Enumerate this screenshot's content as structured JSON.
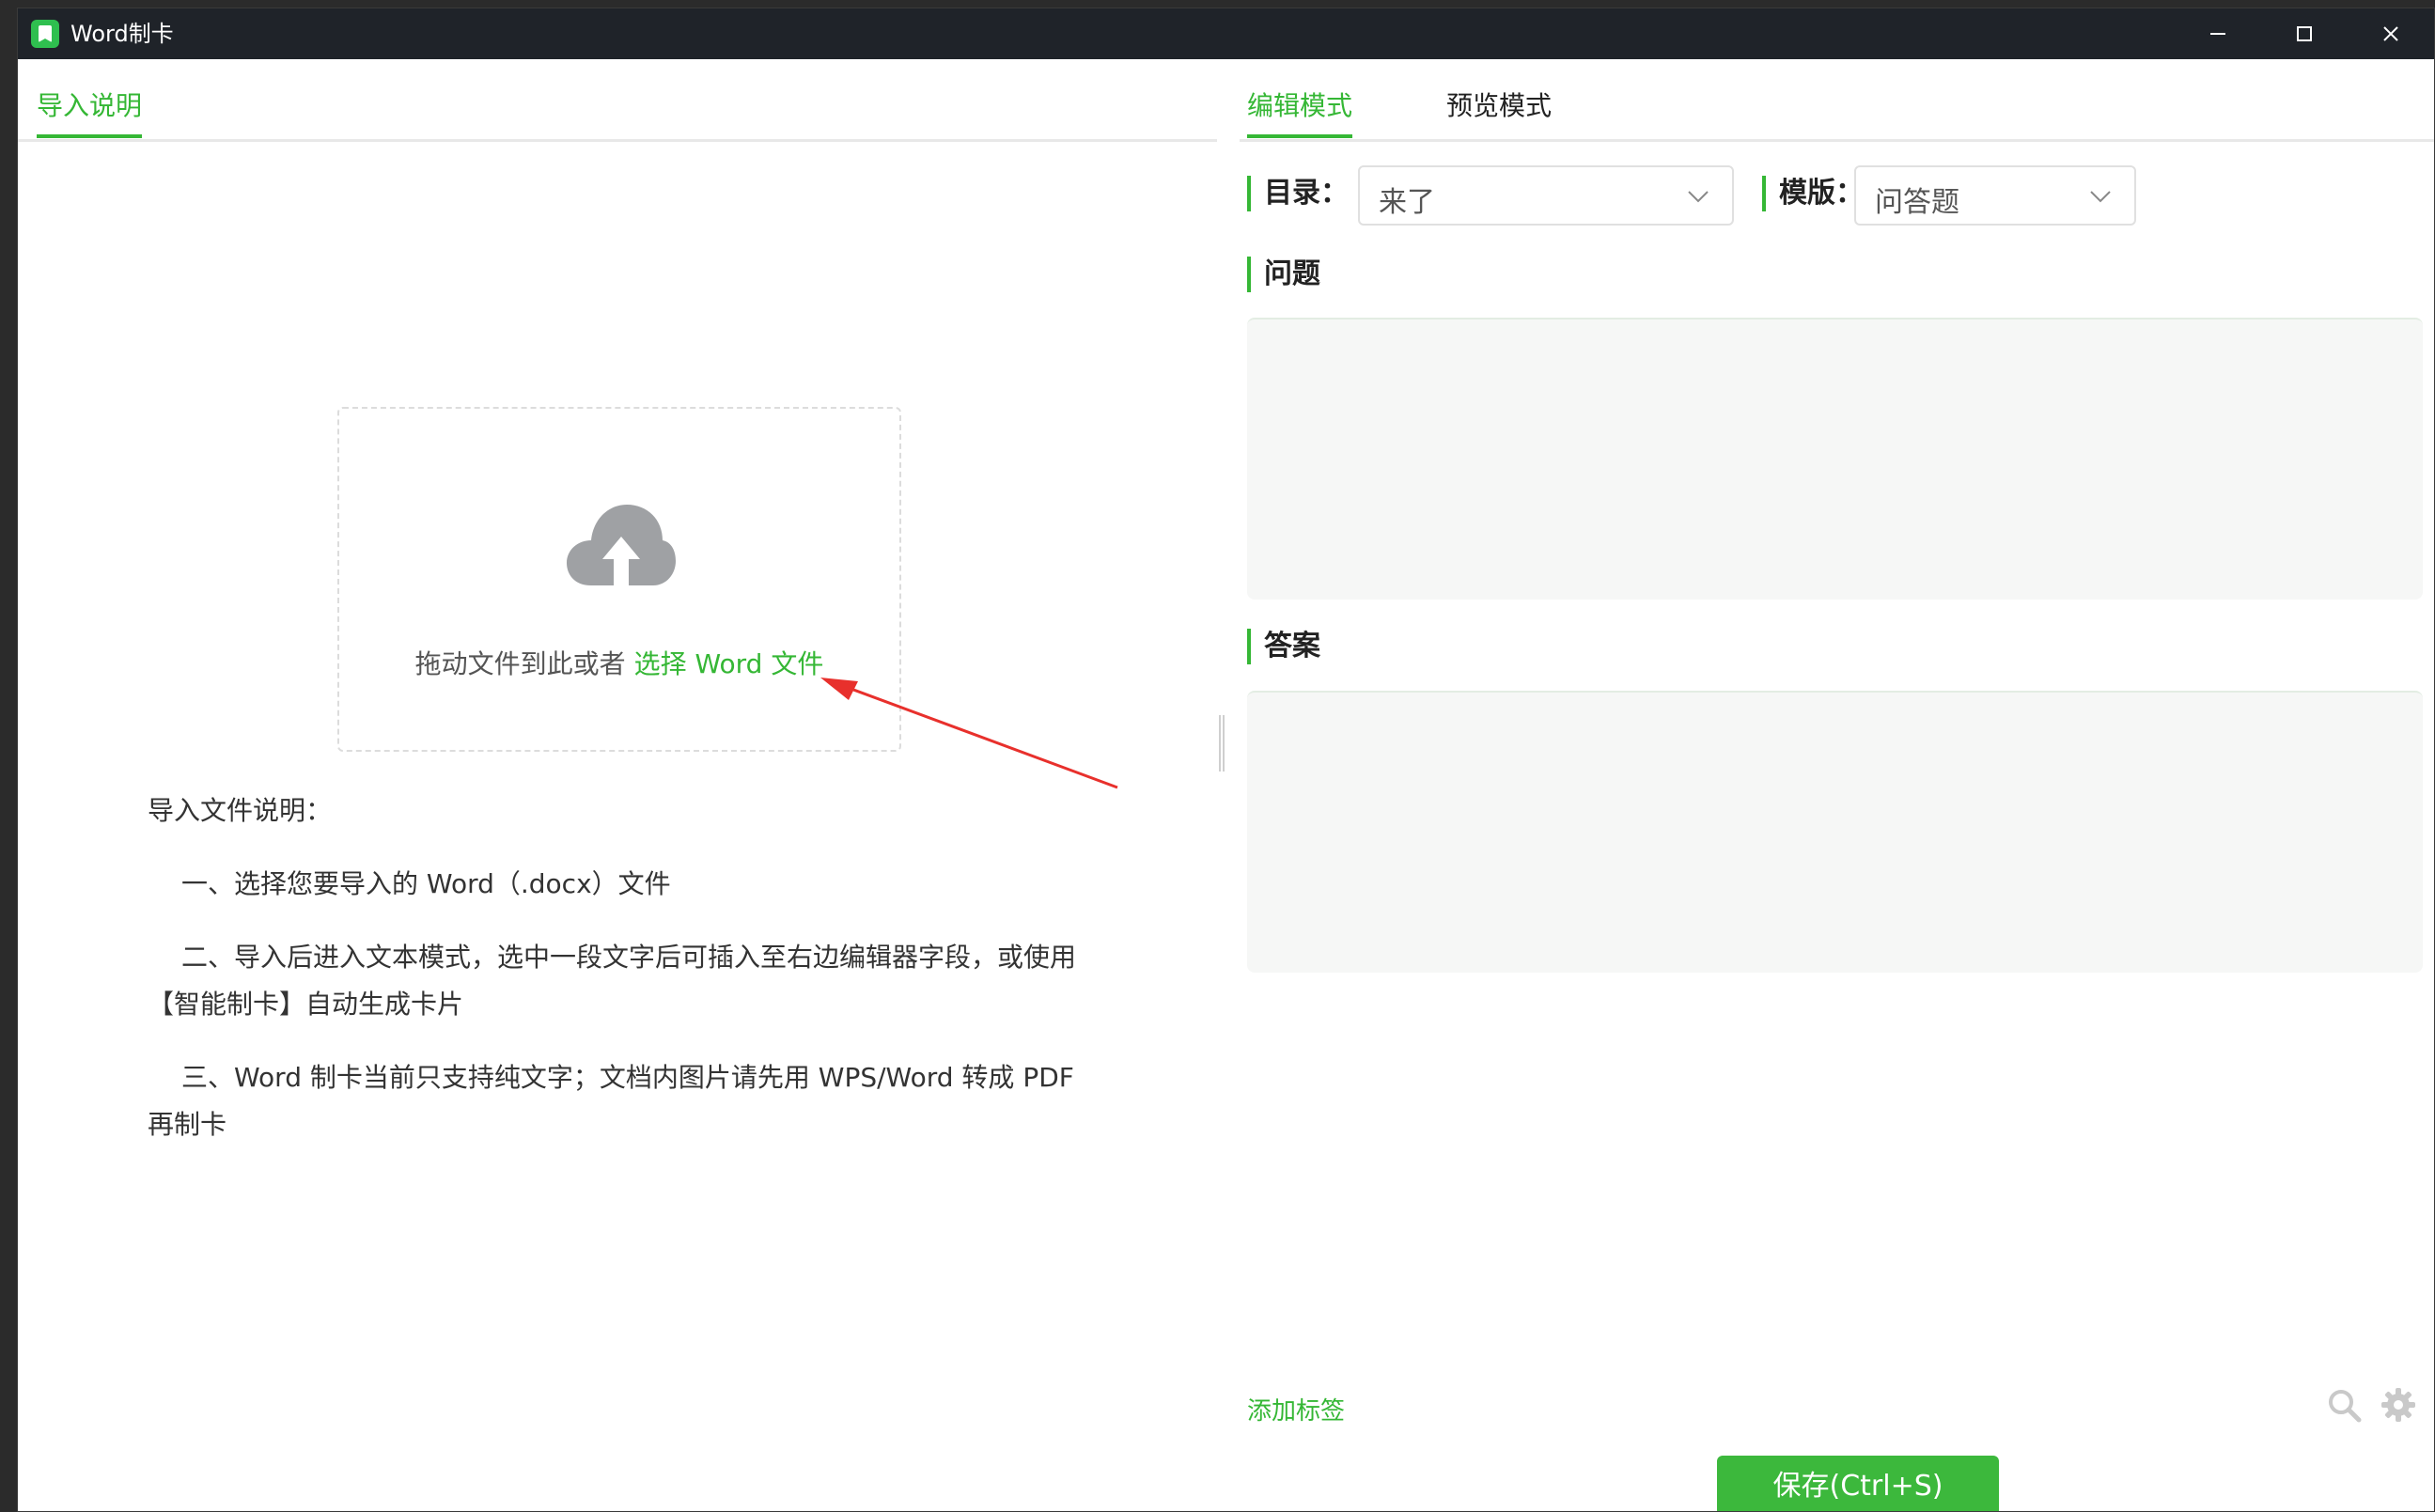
{
  "window": {
    "title": "Word制卡"
  },
  "left_panel": {
    "tab_label": "导入说明",
    "dropzone": {
      "text": "拖动文件到此或者",
      "link": "选择 Word 文件"
    },
    "notes": {
      "heading": "导入文件说明：",
      "items": [
        "一、选择您要导入的 Word（.docx）文件",
        "二、导入后进入文本模式，选中一段文字后可插入至右边编辑器字段，或使用【智能制卡】自动生成卡片",
        "三、Word 制卡当前只支持纯文字；文档内图片请先用 WPS/Word 转成 PDF 再制卡"
      ]
    }
  },
  "right_panel": {
    "tabs": [
      "编辑模式",
      "预览模式"
    ],
    "directory_label": "目录：",
    "directory_value": "来了",
    "template_label": "模版：",
    "template_value": "问答题",
    "question_label": "问题",
    "answer_label": "答案",
    "add_tag": "添加标签",
    "save_button": "保存(Ctrl+S)"
  },
  "colors": {
    "accent": "#35b735",
    "titlebar": "#1f2329",
    "panel_bg": "#f6f7f6"
  }
}
